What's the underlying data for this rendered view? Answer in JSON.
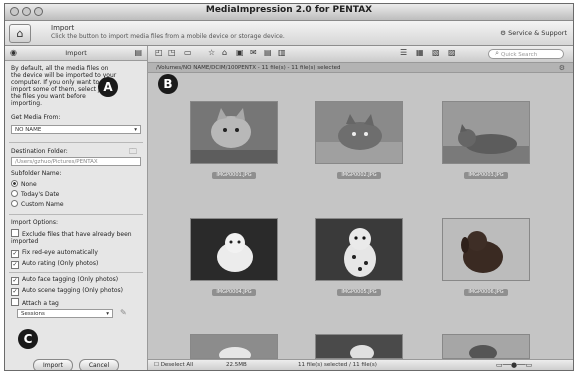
{
  "window": {
    "title": "MediaImpression 2.0 for PENTAX"
  },
  "header": {
    "title": "Import",
    "subtitle": "Click the button to import media files from a mobile device or storage device.",
    "service_label": "Service & Support"
  },
  "left_panel": {
    "title": "Import",
    "description": "By default, all the media files on the device will be imported to your computer. If you only want to import some of them, select just the files you want before importing.",
    "get_media_label": "Get Media From:",
    "get_media_value": "NO NAME",
    "destination_label": "Destination Folder:",
    "destination_value": "/Users/gzhuo/Pictures/PENTAX",
    "subfolder_label": "Subfolder Name:",
    "subfolder_options": [
      "None",
      "Today's Date",
      "Custom Name"
    ],
    "import_options_label": "Import Options:",
    "options": [
      {
        "label": "Exclude files that have already been imported",
        "checked": false
      },
      {
        "label": "Fix red-eye automatically",
        "checked": true
      },
      {
        "label": "Auto rating (Only photos)",
        "checked": true
      },
      {
        "label": "Auto face tagging (Only photos)",
        "checked": true
      },
      {
        "label": "Auto scene tagging (Only photos)",
        "checked": true
      },
      {
        "label": "Attach a tag",
        "checked": false
      }
    ],
    "tag_value": "Sessions",
    "import_button": "Import",
    "cancel_button": "Cancel"
  },
  "browser": {
    "path": "/Volumes/NO NAME/DCIM/100PENTX - 11 file(s) - 11 file(s) selected",
    "search_placeholder": "Quick Search",
    "thumbnails": [
      {
        "caption": "IMGP0001.JPG"
      },
      {
        "caption": "IMGP0002.JPG"
      },
      {
        "caption": "IMGP0003.JPG"
      },
      {
        "caption": "IMGP0004.JPG"
      },
      {
        "caption": "IMGP0005.JPG"
      },
      {
        "caption": "IMGP0006.JPG"
      }
    ],
    "status": {
      "deselect": "Deselect All",
      "size": "22.5MB",
      "count": "11 file(s) selected / 11 file(s)"
    }
  },
  "callouts": {
    "a": "A",
    "b": "B",
    "c": "C"
  }
}
